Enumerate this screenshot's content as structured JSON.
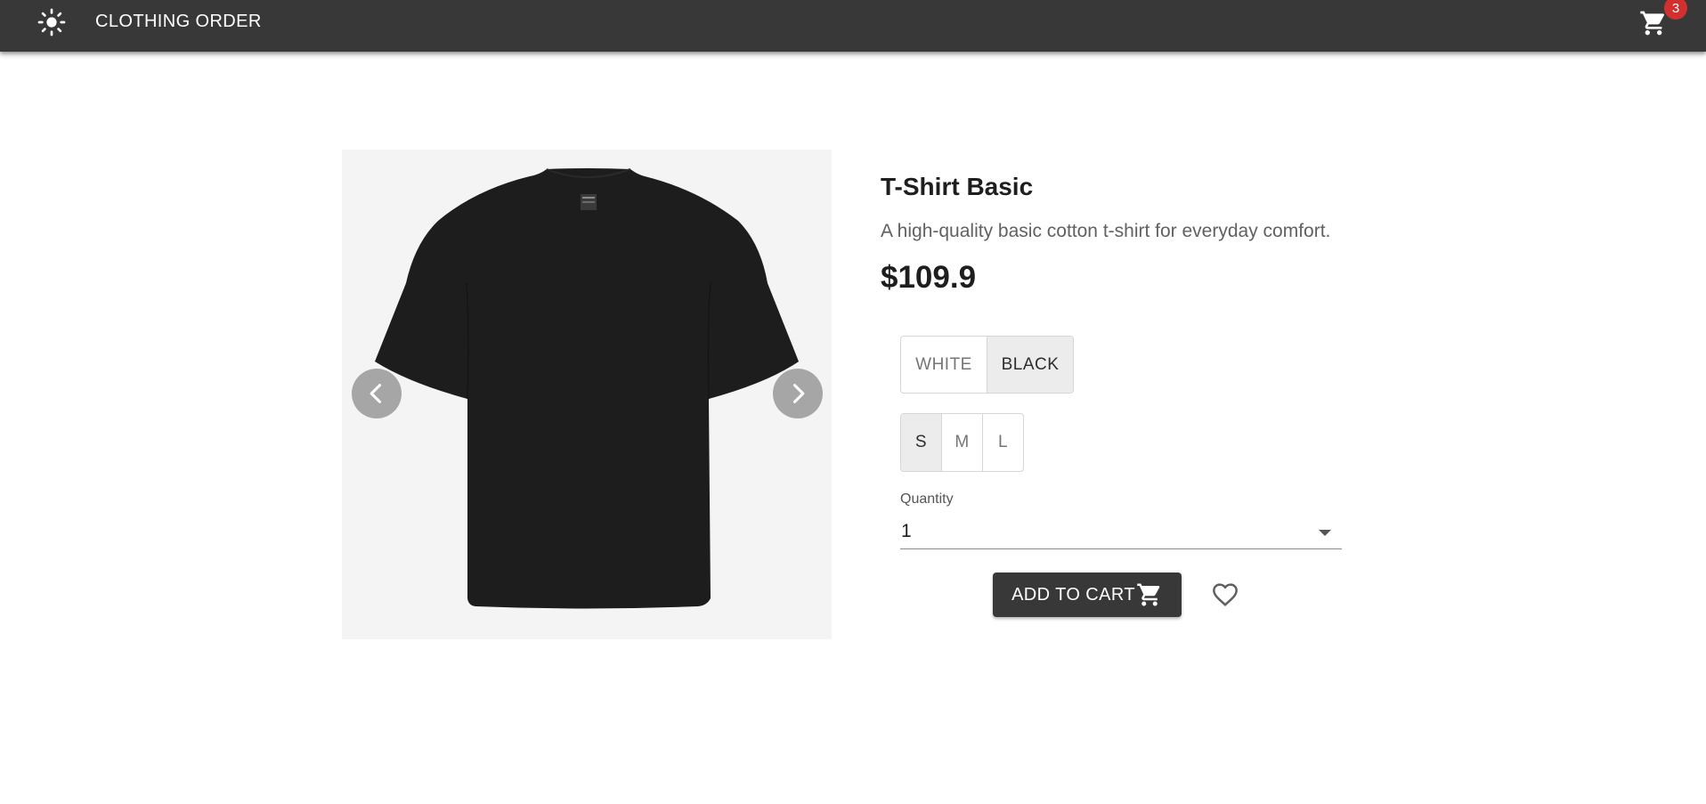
{
  "colors": {
    "appbar": "#383838",
    "badge": "#d32f2f",
    "button": "#383838"
  },
  "header": {
    "title": "CLOTHING ORDER",
    "theme_icon": "sun-icon",
    "cart_icon": "cart-icon",
    "cart_count": "3"
  },
  "gallery": {
    "prev_icon": "chevron-left-icon",
    "next_icon": "chevron-right-icon"
  },
  "product": {
    "name": "T-Shirt Basic",
    "description": "A high-quality basic cotton t-shirt for everyday comfort.",
    "price": "$109.9",
    "colors": [
      {
        "label": "WHITE",
        "selected": false
      },
      {
        "label": "BLACK",
        "selected": true
      }
    ],
    "sizes": [
      {
        "label": "S",
        "selected": true
      },
      {
        "label": "M",
        "selected": false
      },
      {
        "label": "L",
        "selected": false
      }
    ],
    "quantity": {
      "label": "Quantity",
      "value": "1"
    }
  },
  "actions": {
    "add_to_cart": "ADD TO CART",
    "add_icon": "cart-icon",
    "wishlist_icon": "heart-outline-icon"
  }
}
